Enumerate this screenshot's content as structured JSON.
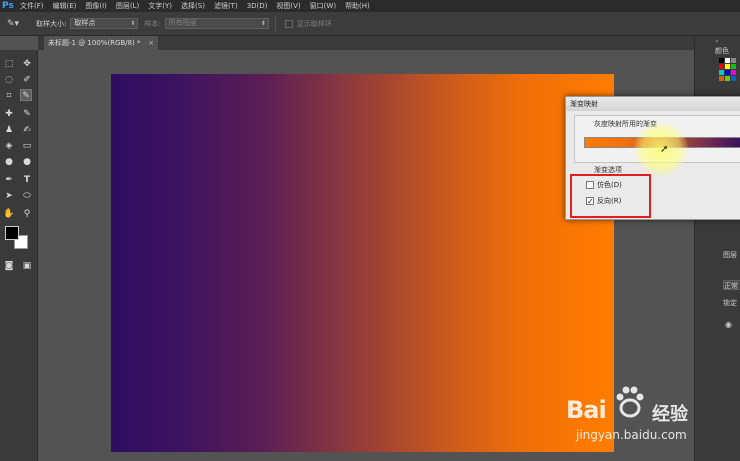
{
  "app": {
    "logo": "Ps"
  },
  "menu": [
    "文件(F)",
    "编辑(E)",
    "图像(I)",
    "图层(L)",
    "文字(Y)",
    "选择(S)",
    "滤镜(T)",
    "3D(D)",
    "视图(V)",
    "窗口(W)",
    "帮助(H)"
  ],
  "options": {
    "sample_size_label": "取样大小:",
    "sample_size_value": "取样点",
    "sample_label": "样本:",
    "sample_value": "所有图层",
    "ring_label": "显示取样环"
  },
  "document": {
    "tab_title": "未标题-1 @ 100%(RGB/8) *",
    "close": "×"
  },
  "dialog": {
    "title": "渐变映射",
    "group_label": "灰度映射所用的渐变",
    "options_label": "渐变选项",
    "dither_label": "仿色(D)",
    "dither_checked": false,
    "reverse_label": "反向(R)",
    "reverse_checked": true,
    "check_mark": "✓"
  },
  "right_panel": {
    "color_tab": "颜色",
    "layers_tab": "图层",
    "normal": "正常",
    "lock": "锁定"
  },
  "watermark": {
    "brand": "Bai",
    "brand2": "经验",
    "url": "jingyan.baidu.com"
  },
  "colors": {
    "gradient_start": "#2e0e62",
    "gradient_end": "#ff7d00",
    "highlight_box": "#e02020"
  }
}
